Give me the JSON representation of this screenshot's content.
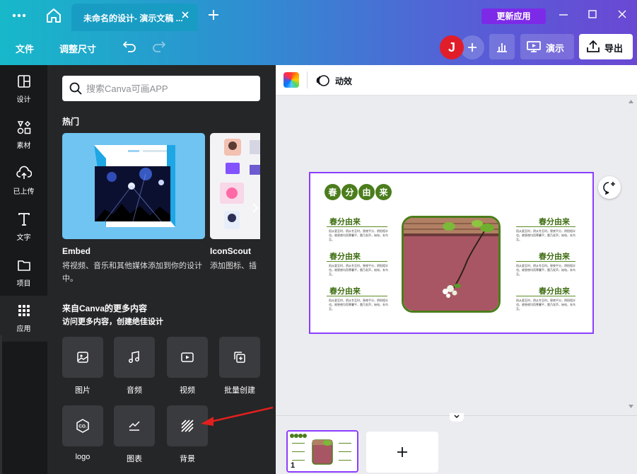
{
  "titlebar": {
    "tab_title": "未命名的设计- 演示文稿 ...",
    "update_button": "更新应用"
  },
  "toolbar": {
    "file": "文件",
    "resize": "调整尺寸",
    "avatar_initial": "J",
    "present": "演示",
    "export": "导出"
  },
  "rail": {
    "items": [
      {
        "label": "设计",
        "icon": "layout-icon"
      },
      {
        "label": "素材",
        "icon": "shapes-icon"
      },
      {
        "label": "已上传",
        "icon": "upload-cloud-icon"
      },
      {
        "label": "文字",
        "icon": "text-icon"
      },
      {
        "label": "项目",
        "icon": "folder-icon"
      },
      {
        "label": "应用",
        "icon": "apps-grid-icon"
      }
    ]
  },
  "panel": {
    "search_placeholder": "搜索Canva可画APP",
    "popular_title": "热门",
    "cards": [
      {
        "title": "Embed",
        "desc_line1": "将视频、音乐和其他媒体添加到你的设计",
        "desc_line2": "中。"
      },
      {
        "title": "IconScout",
        "desc_line1": "添加图标、插"
      }
    ],
    "more_title": "来自Canva的更多内容",
    "more_subtitle": "访问更多内容，创建绝佳设计",
    "apps": [
      {
        "label": "图片",
        "icon": "image-icon"
      },
      {
        "label": "音频",
        "icon": "music-icon"
      },
      {
        "label": "视频",
        "icon": "video-icon"
      },
      {
        "label": "批量创建",
        "icon": "bulk-create-icon"
      },
      {
        "label": "logo",
        "icon": "logo-icon"
      },
      {
        "label": "图表",
        "icon": "chart-icon"
      },
      {
        "label": "背景",
        "icon": "background-icon"
      }
    ]
  },
  "canvas": {
    "animate_label": "动效",
    "page_number": "1",
    "slide": {
      "title_chars": [
        "春",
        "分",
        "由",
        "来"
      ],
      "section_heading": "春分由来",
      "section_text": "阳从夏至时，阴从冬至时。昼夜平分，阴阳相半也。故昼夜均而寒暑平，雷乃发声，始电，玄鸟至。"
    }
  },
  "colors": {
    "accent_purple": "#8b3dff",
    "update_purple": "#7d2ae8",
    "avatar_red": "#e11d2a",
    "slide_green": "#4b7d1c",
    "panel_dark": "#252627",
    "rail_dark": "#18191b"
  }
}
